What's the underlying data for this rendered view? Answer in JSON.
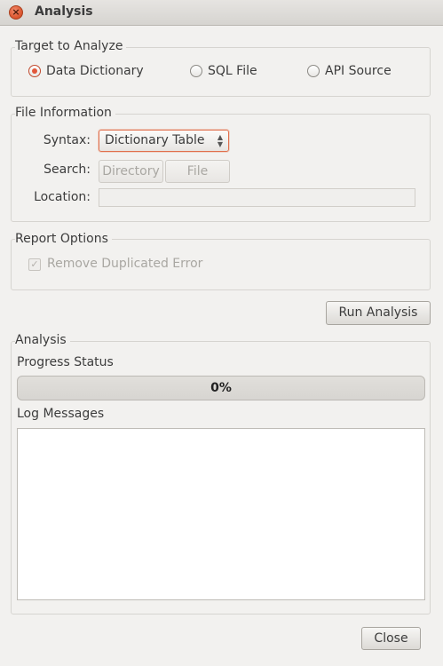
{
  "window": {
    "title": "Analysis"
  },
  "target_group": {
    "label": "Target to Analyze",
    "options": [
      {
        "label": "Data Dictionary",
        "checked": true
      },
      {
        "label": "SQL File",
        "checked": false
      },
      {
        "label": "API Source",
        "checked": false
      }
    ]
  },
  "file_info": {
    "label": "File Information",
    "syntax_label": "Syntax:",
    "syntax_value": "Dictionary Table",
    "search_label": "Search:",
    "directory_button": "Directory",
    "file_button": "File",
    "location_label": "Location:",
    "location_value": ""
  },
  "report_options": {
    "label": "Report Options",
    "remove_dup_label": "Remove Duplicated Error",
    "remove_dup_checked": true
  },
  "run_button": "Run Analysis",
  "analysis": {
    "label": "Analysis",
    "progress_label": "Progress Status",
    "progress_text": "0%",
    "progress_value": 0,
    "log_label": "Log Messages",
    "log_text": ""
  },
  "close_button": "Close",
  "colors": {
    "accent": "#e2573a",
    "background": "#f2f1ef"
  }
}
